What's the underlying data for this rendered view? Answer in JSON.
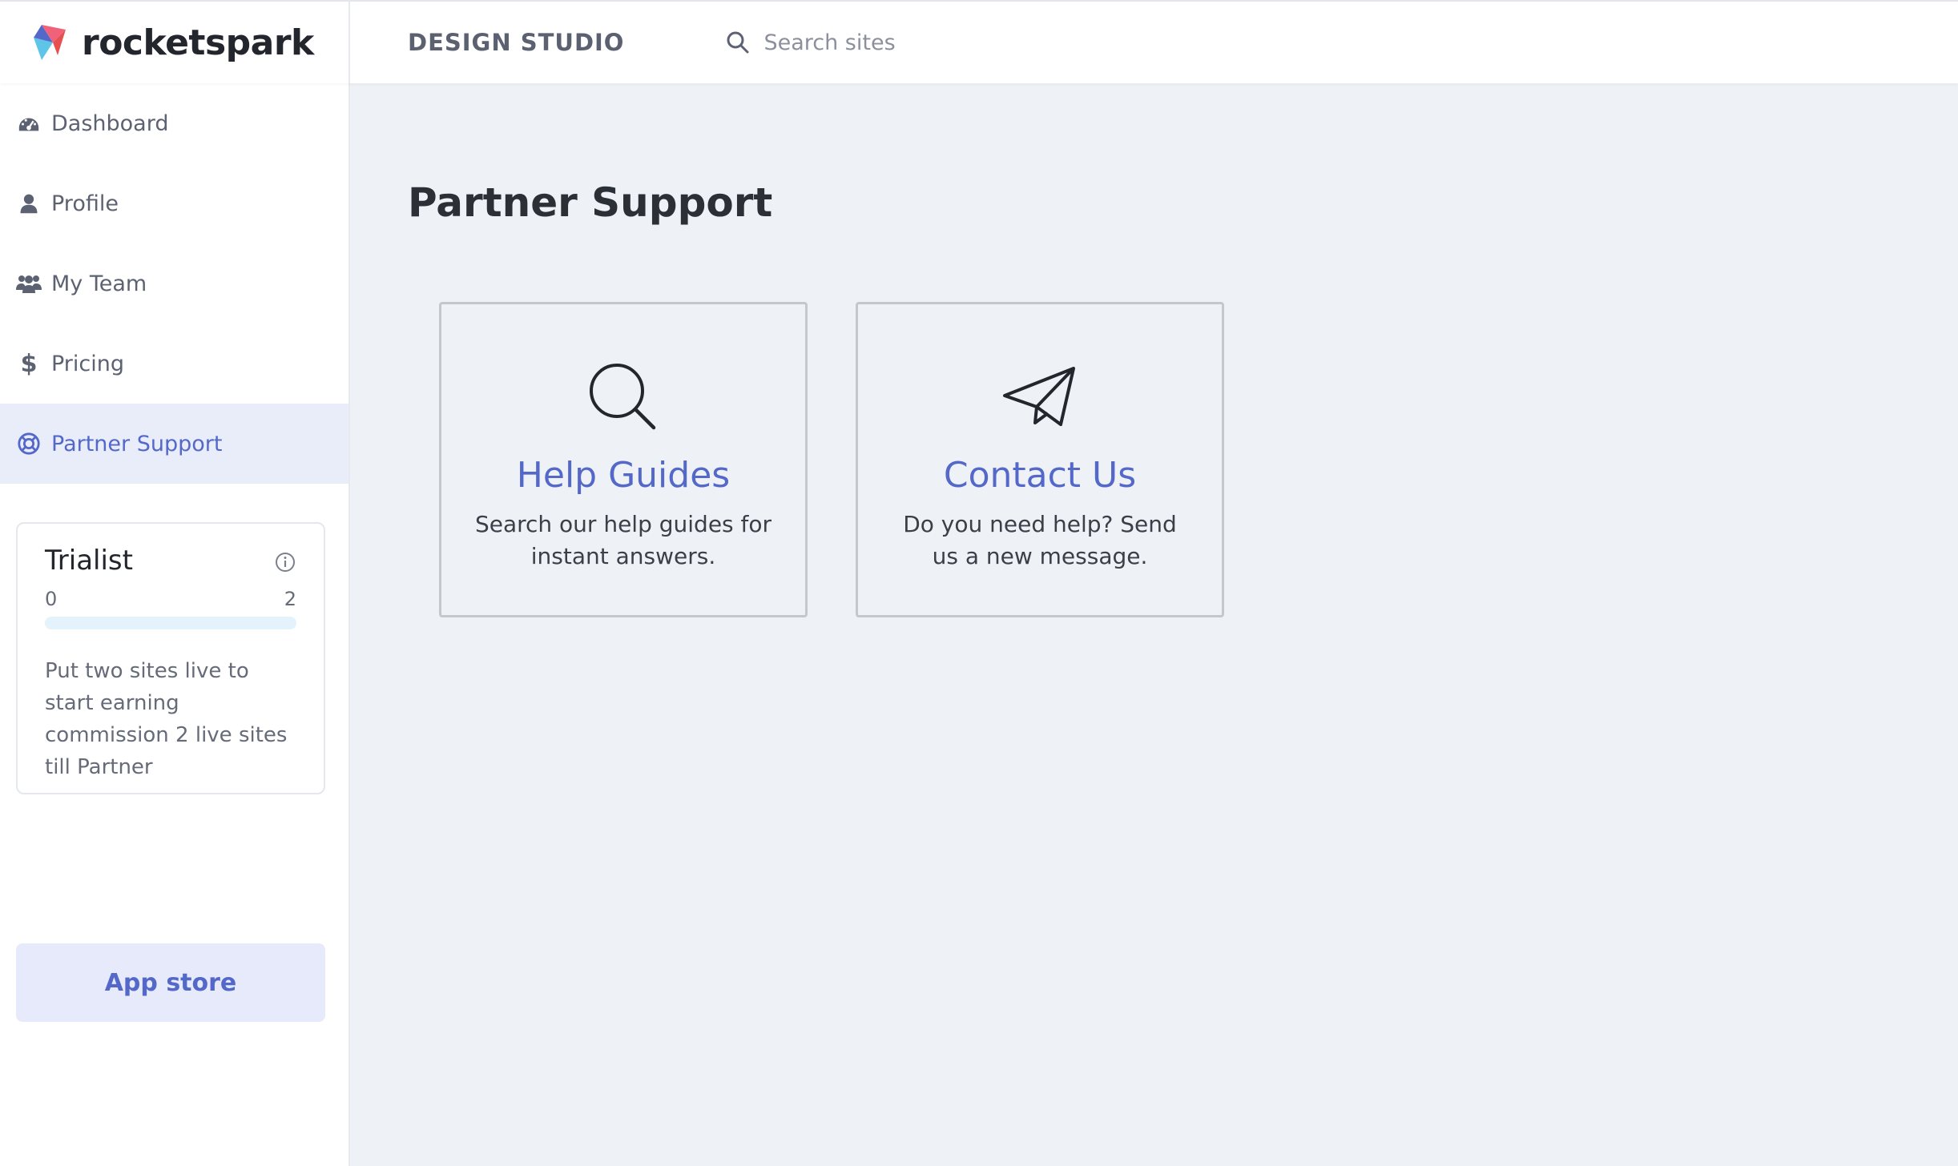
{
  "header": {
    "logo_text": "rocketspark",
    "section_label": "DESIGN STUDIO",
    "search_placeholder": "Search sites"
  },
  "sidebar": {
    "items": [
      {
        "label": "Dashboard",
        "icon": "dashboard-icon"
      },
      {
        "label": "Profile",
        "icon": "user-icon"
      },
      {
        "label": "My Team",
        "icon": "team-icon"
      },
      {
        "label": "Pricing",
        "icon": "dollar-icon"
      },
      {
        "label": "Partner Support",
        "icon": "lifebuoy-icon",
        "active": true
      }
    ],
    "tier": {
      "title": "Trialist",
      "min": "0",
      "max": "2",
      "progress": 0,
      "description": "Put two sites live to start earning commission 2 live sites till Partner"
    },
    "app_store_label": "App store"
  },
  "main": {
    "title": "Partner Support",
    "cards": [
      {
        "title": "Help Guides",
        "description": "Search our help guides for instant answers.",
        "icon": "search-icon"
      },
      {
        "title": "Contact Us",
        "description": "Do you need help? Send us a new message.",
        "icon": "paper-plane-icon"
      }
    ]
  },
  "colors": {
    "accent": "#5468c9",
    "active_bg": "#e9edfa",
    "page_bg": "#eef1f6"
  }
}
